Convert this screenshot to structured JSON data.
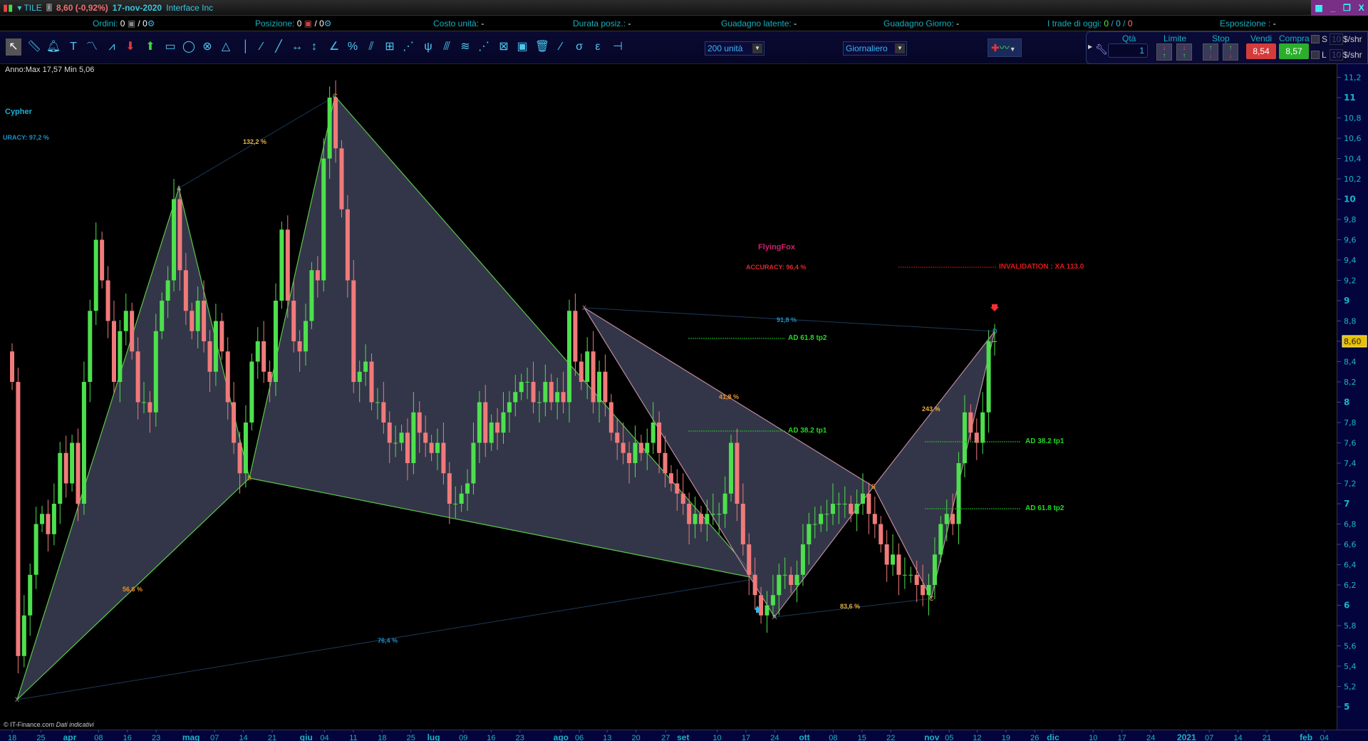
{
  "titlebar": {
    "symbol": "TILE",
    "price_change": "8,60 (-0,92%)",
    "date": "17-nov-2020",
    "company": "Interface Inc",
    "window_buttons": [
      "keyboard",
      "_",
      "restore",
      "X"
    ]
  },
  "inforow": {
    "ordini_label": "Ordini:",
    "ordini_value": "0",
    "ordini_sep": "/ 0",
    "posizione_label": "Posizione:",
    "posizione_value": "0",
    "posizione_sep": "/ 0",
    "costo_label": "Costo unità:",
    "costo_value": "-",
    "durata_label": "Durata posiz.:",
    "durata_value": "-",
    "latente_label": "Guadagno latente:",
    "latente_value": "-",
    "giorno_label": "Guadagno Giorno:",
    "giorno_value": "-",
    "trade_label": "I trade di oggi:",
    "trade_v1": "0",
    "trade_v2": "0",
    "trade_v3": "0",
    "esposizione_label": "Esposizione :",
    "esposizione_value": "-"
  },
  "toolbar": {
    "tools": [
      "cursor",
      "ruler",
      "alert-bell",
      "text",
      "trend-indicator",
      "zigzag",
      "arrow-down",
      "arrow-up",
      "rectangle",
      "ellipse",
      "circle-cross",
      "triangle",
      "vertical-line",
      "segment",
      "line",
      "horizontal-range",
      "vertical-range",
      "angle",
      "percent-retracement",
      "fibonacci-fan",
      "fibonacci-grid",
      "gann-fan",
      "pitchfork",
      "channel",
      "raff-channel",
      "speed-lines",
      "gann-grid",
      "gann-square",
      "trash",
      "gann-line",
      "sigma-channel",
      "epsilon-channel",
      "horizontal-line"
    ],
    "quantity_select": "200 unità",
    "period_select": "Giornaliero"
  },
  "trade_panel": {
    "qta_label": "Qtà",
    "qta_value": "1",
    "limite_label": "Limite",
    "stop_label": "Stop",
    "vendi_label": "Vendi",
    "vendi_price": "8,54",
    "compra_label": "Compra",
    "compra_price": "8,57",
    "s_label": "S",
    "l_label": "L",
    "s_value": "10",
    "l_value": "10",
    "unit": "$/shr"
  },
  "chart_data": {
    "type": "candlestick",
    "range_label": "Anno:Max 17,57 Min 5,06",
    "last_price_label": "8,60",
    "ylim": [
      5,
      11.2
    ],
    "y_ticks": [
      "5",
      "5,2",
      "5,4",
      "5,6",
      "5,8",
      "6",
      "6,2",
      "6,4",
      "6,6",
      "6,8",
      "7",
      "7,2",
      "7,4",
      "7,6",
      "7,8",
      "8",
      "8,2",
      "8,4",
      "8,6",
      "8,8",
      "9",
      "9,2",
      "9,4",
      "9,6",
      "9,8",
      "10",
      "10,2",
      "10,4",
      "10,6",
      "10,8",
      "11",
      "11,2"
    ],
    "x_ticks": [
      "18",
      "25",
      "apr",
      "08",
      "16",
      "23",
      "mag",
      "07",
      "14",
      "21",
      "giu",
      "04",
      "11",
      "18",
      "25",
      "lug",
      "09",
      "16",
      "23",
      "ago",
      "06",
      "13",
      "20",
      "27",
      "set",
      "10",
      "17",
      "24",
      "ott",
      "08",
      "15",
      "22",
      "nov",
      "05",
      "12",
      "19",
      "26",
      "dic",
      "10",
      "17",
      "24",
      "2021",
      "07",
      "14",
      "21",
      "feb",
      "04"
    ],
    "closes": [
      8.2,
      5.5,
      5.9,
      6.3,
      6.8,
      6.9,
      6.7,
      7.0,
      7.5,
      7.2,
      7.6,
      7.0,
      8.2,
      8.9,
      9.6,
      9.2,
      8.8,
      8.2,
      8.7,
      8.9,
      8.5,
      8.0,
      8.0,
      7.9,
      8.7,
      9.0,
      9.2,
      10.0,
      9.3,
      8.9,
      8.7,
      9.0,
      8.6,
      8.3,
      8.8,
      8.5,
      8.0,
      7.6,
      7.3,
      7.8,
      8.4,
      8.6,
      8.3,
      8.2,
      9.0,
      9.7,
      9.0,
      8.6,
      8.5,
      8.8,
      9.3,
      9.2,
      10.4,
      11.0,
      10.5,
      9.9,
      9.2,
      8.2,
      8.3,
      8.4,
      8.0,
      8.0,
      7.8,
      7.6,
      7.6,
      7.7,
      7.4,
      7.9,
      7.7,
      7.6,
      7.5,
      7.6,
      7.3,
      7.0,
      7.0,
      7.1,
      7.2,
      7.6,
      8.0,
      7.6,
      7.8,
      7.7,
      7.9,
      8.0,
      8.1,
      8.2,
      8.2,
      8.0,
      8.0,
      8.2,
      8.0,
      8.1,
      8.0,
      8.9,
      8.4,
      8.2,
      8.5,
      8.0,
      8.3,
      8.0,
      7.7,
      7.6,
      7.5,
      7.4,
      7.6,
      7.5,
      7.6,
      7.8,
      7.5,
      7.3,
      7.2,
      7.1,
      7.0,
      6.8,
      6.9,
      6.8,
      6.9,
      6.9,
      6.9,
      7.1,
      7.6,
      7.0,
      6.6,
      6.3,
      6.1,
      5.9,
      6.0,
      6.1,
      6.3,
      6.3,
      6.2,
      6.3,
      6.6,
      6.8,
      6.8,
      6.9,
      6.9,
      7.0,
      7.0,
      7.0,
      6.9,
      7.0,
      7.1,
      6.9,
      6.8,
      6.6,
      6.4,
      6.5,
      6.3,
      6.3,
      6.3,
      6.2,
      6.1,
      6.2,
      6.5,
      6.8,
      6.9,
      6.8,
      7.4,
      7.9,
      7.7,
      7.6,
      7.9,
      8.6,
      8.6
    ],
    "colors": {
      "up": "#4de04d",
      "down": "#f07a7a",
      "cypher_outline": "#5cc84a",
      "flyingfox_outline": "#c08aa0",
      "pattern_fill": "#3c3f55"
    },
    "patterns": [
      {
        "name": "Cypher",
        "accuracy": "URACY: 97,2 %",
        "points": {
          "X": [
            5.06,
            "18-mar"
          ],
          "A": [
            10.1,
            "apr"
          ],
          "B": [
            7.2,
            "mag"
          ],
          "C": [
            11.0,
            "giu"
          ],
          "D": [
            6.25,
            "set"
          ]
        },
        "ratios": [
          "132,2 %",
          "56,6 %",
          "76,4 %"
        ]
      },
      {
        "name": "FlyingFox",
        "accuracy": "ACCURACY: 96,4 %",
        "invalidation": "INVALIDATION :  XA 113.0",
        "ratios": [
          "91,8 %",
          "41,8 %",
          "83,6 %",
          "243 %"
        ]
      }
    ],
    "targets": [
      "AD 61.8 tp2",
      "AD 38.2 tp1",
      "AD 38.2 tp1",
      "AD 61.8 tp2"
    ],
    "point_labels": [
      "X",
      "A",
      "B",
      "C",
      "D"
    ],
    "footer": "© IT-Finance.com",
    "footer_note": "Dati indicativi"
  }
}
